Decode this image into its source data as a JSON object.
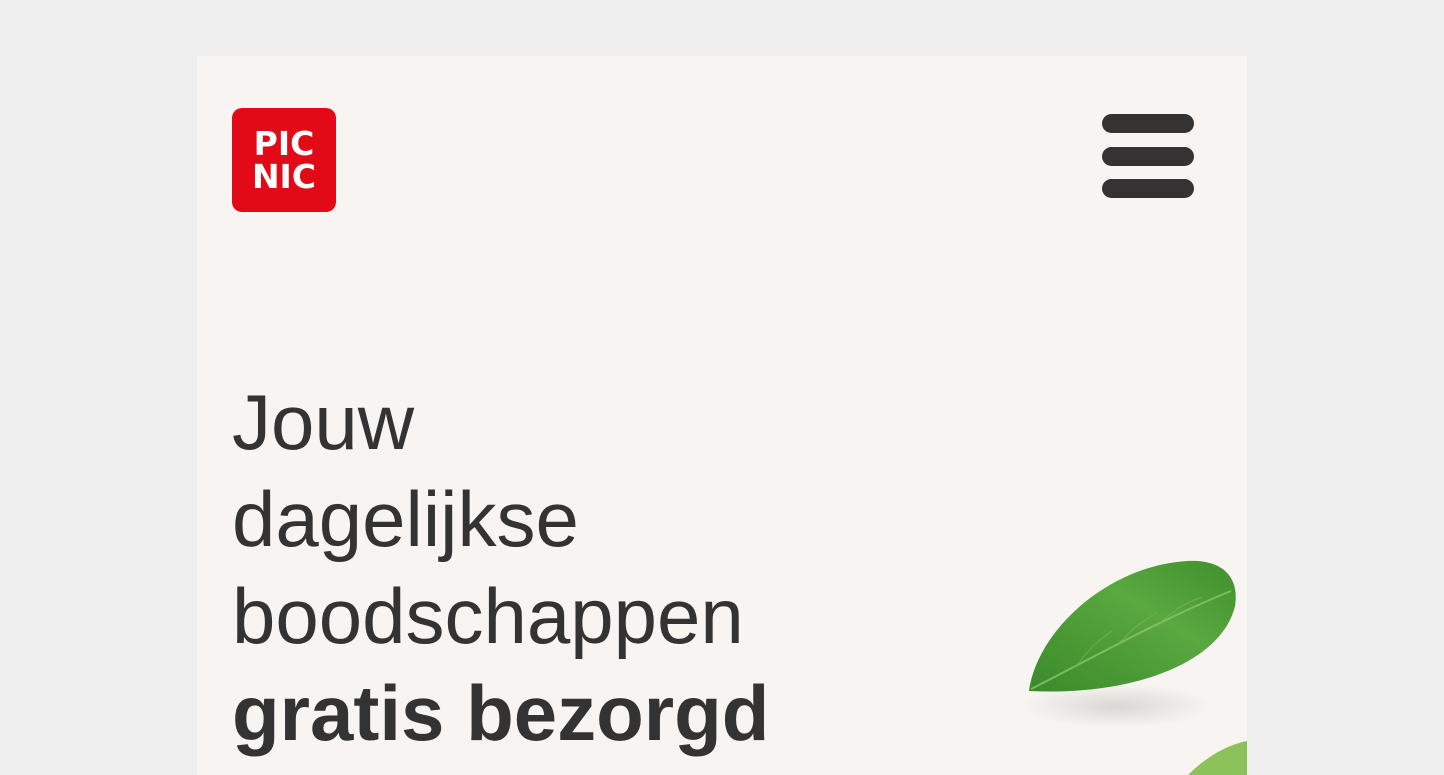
{
  "header": {
    "logo_line1": "PIC",
    "logo_line2": "NIC"
  },
  "hero": {
    "line1": "Jouw",
    "line2": "dagelijkse",
    "line3": "boodschappen",
    "line4": "gratis bezorgd"
  },
  "colors": {
    "brand_red": "#e30a17",
    "text_dark": "#333333",
    "page_bg": "#f7f4f1",
    "outer_bg": "#efefef",
    "leaf_green": "#4a9a34"
  },
  "icons": {
    "menu": "hamburger-menu-icon",
    "decoration": "leaf-icon"
  }
}
